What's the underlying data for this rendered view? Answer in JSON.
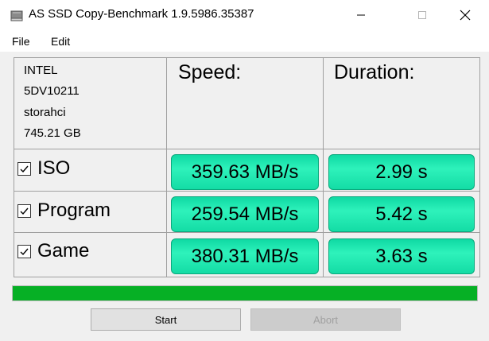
{
  "window": {
    "title": "AS SSD Copy-Benchmark 1.9.5986.35387",
    "controls": [
      "minimize-icon",
      "maximize-icon",
      "close-icon"
    ]
  },
  "menu": {
    "items": [
      "File",
      "Edit"
    ]
  },
  "drive": {
    "vendor": "INTEL",
    "model": "5DV10211",
    "driver": "storahci",
    "size": "745.21 GB"
  },
  "headers": {
    "speed": "Speed:",
    "duration": "Duration:"
  },
  "rows": [
    {
      "label": "ISO",
      "checked": true,
      "speed": "359.63 MB/s",
      "duration": "2.99 s"
    },
    {
      "label": "Program",
      "checked": true,
      "speed": "259.54 MB/s",
      "duration": "5.42 s"
    },
    {
      "label": "Game",
      "checked": true,
      "speed": "380.31 MB/s",
      "duration": "3.63 s"
    }
  ],
  "progress": {
    "fraction": 1.0,
    "color": "#06b025"
  },
  "buttons": {
    "start": "Start",
    "abort": "Abort"
  },
  "colors": {
    "result_box": "#1fe3ae",
    "grid": "#a0a0a0"
  }
}
